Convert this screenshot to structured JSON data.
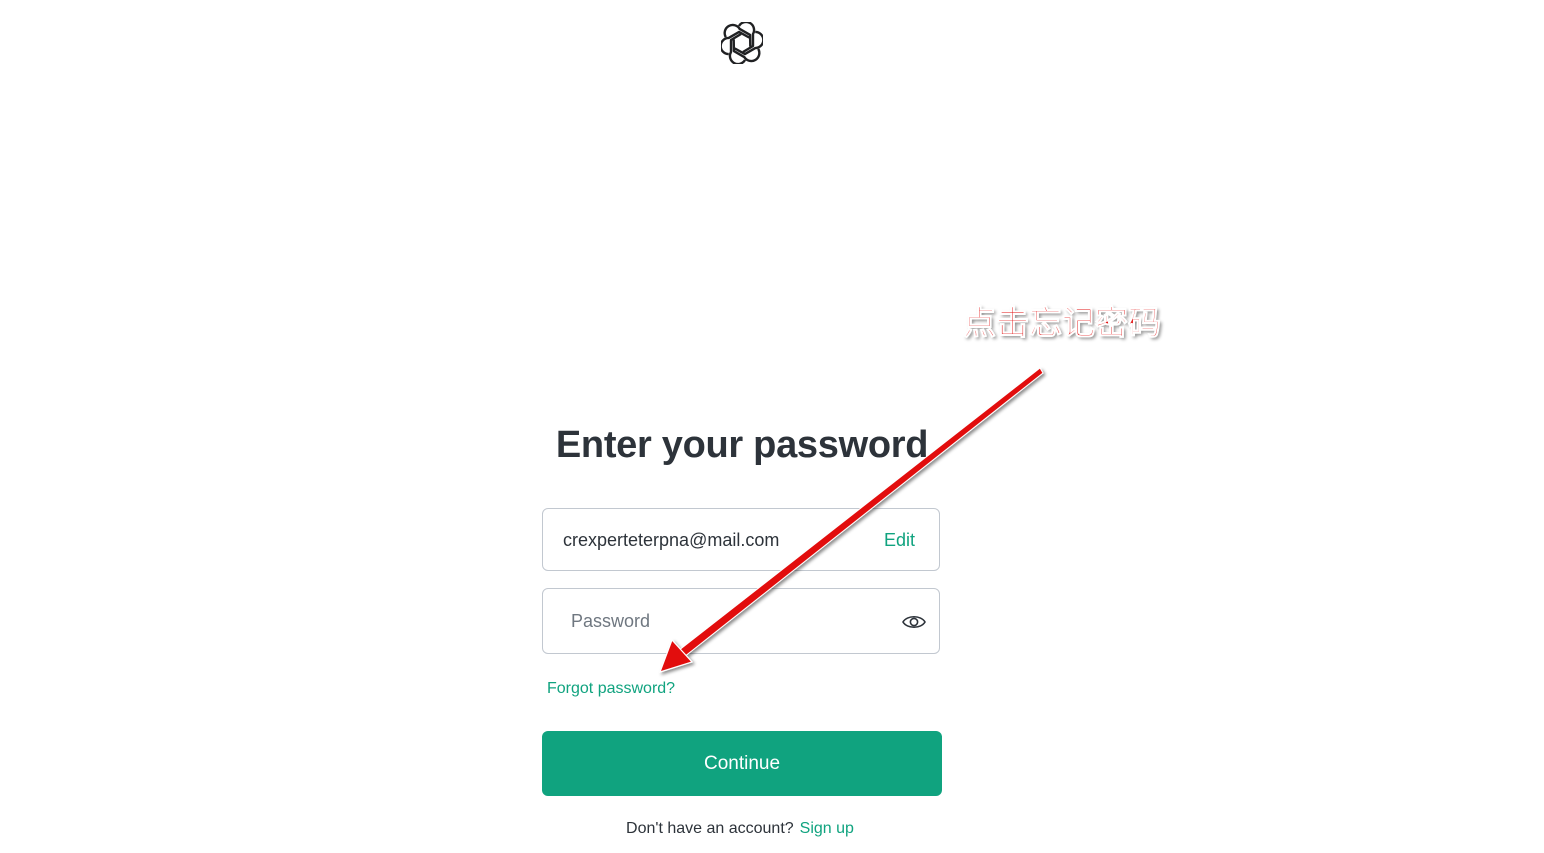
{
  "logo": {
    "icon": "openai-logo-icon"
  },
  "title": "Enter your password",
  "email": {
    "value": "crexperteterpna@mail.com",
    "edit_label": "Edit"
  },
  "password": {
    "placeholder": "Password",
    "toggle_icon": "eye-icon"
  },
  "forgot_label": "Forgot password?",
  "continue_label": "Continue",
  "signup": {
    "prompt": "Don't have an account?",
    "link_label": "Sign up"
  },
  "annotation": {
    "text": "点击忘记密码",
    "color": "#e21010"
  },
  "colors": {
    "accent": "#10a37f",
    "text": "#2d333a",
    "border": "#c2c8d0"
  }
}
